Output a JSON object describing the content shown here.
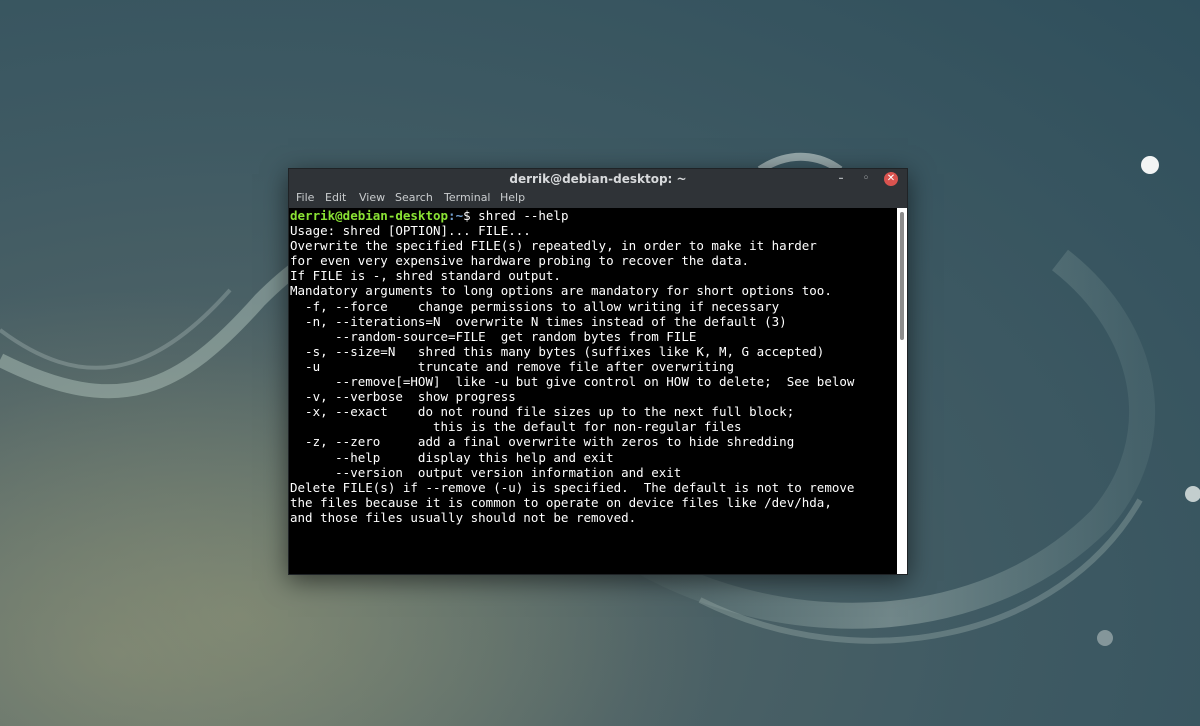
{
  "window": {
    "title": "derrik@debian-desktop: ~",
    "controls": {
      "minimize": "–",
      "maximize": "◦",
      "close": "✕"
    }
  },
  "menu": [
    "File",
    "Edit",
    "View",
    "Search",
    "Terminal",
    "Help"
  ],
  "prompt": {
    "user_host": "derrik@debian-desktop",
    "path": ":~",
    "symbol": "$ ",
    "command": "shred --help"
  },
  "output_lines": [
    "Usage: shred [OPTION]... FILE...",
    "Overwrite the specified FILE(s) repeatedly, in order to make it harder",
    "for even very expensive hardware probing to recover the data.",
    "",
    "If FILE is -, shred standard output.",
    "",
    "Mandatory arguments to long options are mandatory for short options too.",
    "  -f, --force    change permissions to allow writing if necessary",
    "  -n, --iterations=N  overwrite N times instead of the default (3)",
    "      --random-source=FILE  get random bytes from FILE",
    "  -s, --size=N   shred this many bytes (suffixes like K, M, G accepted)",
    "  -u             truncate and remove file after overwriting",
    "      --remove[=HOW]  like -u but give control on HOW to delete;  See below",
    "  -v, --verbose  show progress",
    "  -x, --exact    do not round file sizes up to the next full block;",
    "                   this is the default for non-regular files",
    "  -z, --zero     add a final overwrite with zeros to hide shredding",
    "      --help     display this help and exit",
    "      --version  output version information and exit",
    "",
    "Delete FILE(s) if --remove (-u) is specified.  The default is not to remove",
    "the files because it is common to operate on device files like /dev/hda,",
    "and those files usually should not be removed."
  ],
  "colors": {
    "prompt_user": "#8ae234",
    "prompt_path": "#729fcf",
    "terminal_bg": "#000000",
    "terminal_fg": "#ffffff",
    "close_button": "#d9534f"
  }
}
